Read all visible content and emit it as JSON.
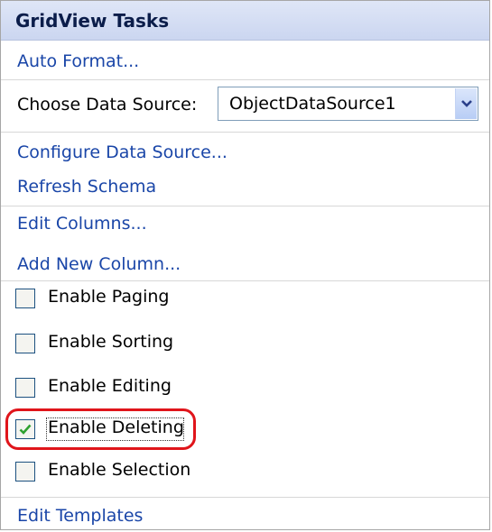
{
  "panel": {
    "title": "GridView Tasks",
    "auto_format": "Auto Format...",
    "data_source": {
      "label": "Choose Data Source:",
      "selected": "ObjectDataSource1"
    },
    "configure_data_source": "Configure Data Source...",
    "refresh_schema": "Refresh Schema",
    "edit_columns": "Edit Columns...",
    "add_new_column": "Add New Column...",
    "options": [
      {
        "label": "Enable Paging",
        "checked": false
      },
      {
        "label": "Enable Sorting",
        "checked": false
      },
      {
        "label": "Enable Editing",
        "checked": false
      },
      {
        "label": "Enable Deleting",
        "checked": true
      },
      {
        "label": "Enable Selection",
        "checked": false
      }
    ],
    "edit_templates": "Edit Templates"
  },
  "colors": {
    "link": "#1a46a8",
    "header_bg": "#cbd6f0",
    "highlight": "#e0151b",
    "check": "#2fa12f"
  },
  "icons": {
    "dropdown": "chevron-down-icon",
    "check": "checkmark-icon"
  }
}
